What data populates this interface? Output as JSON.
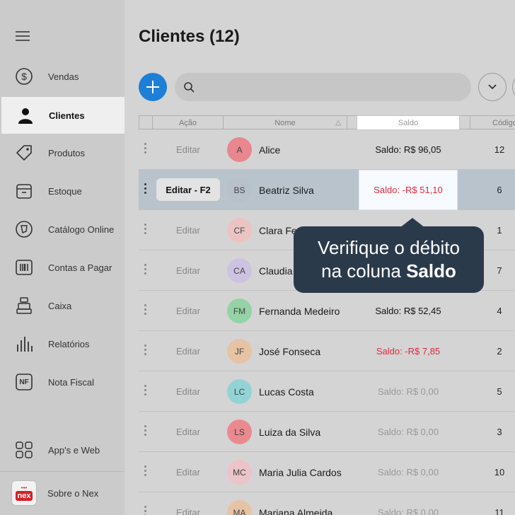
{
  "sidebar": {
    "items": [
      {
        "label": "Vendas",
        "icon": "dollar-circle-icon"
      },
      {
        "label": "Clientes",
        "icon": "person-icon",
        "active": true
      },
      {
        "label": "Produtos",
        "icon": "tag-icon"
      },
      {
        "label": "Estoque",
        "icon": "box-icon"
      },
      {
        "label": "Catálogo Online",
        "icon": "catalog-icon"
      },
      {
        "label": "Contas a Pagar",
        "icon": "barcode-icon"
      },
      {
        "label": "Caixa",
        "icon": "register-icon"
      },
      {
        "label": "Relatórios",
        "icon": "bars-icon"
      },
      {
        "label": "Nota Fiscal",
        "icon": "nf-icon"
      }
    ],
    "apps_label": "App's e Web",
    "about_label": "Sobre o Nex",
    "logo_text": "nex",
    "nf_text": "NF"
  },
  "header": {
    "title": "Clientes (12)"
  },
  "search": {
    "placeholder": ""
  },
  "table": {
    "columns": {
      "acao": "Ação",
      "nome": "Nome",
      "saldo": "Saldo",
      "codigo": "Código"
    },
    "rows": [
      {
        "action": "Editar",
        "initials": "A",
        "name": "Alice",
        "saldo": "Saldo: R$ 96,05",
        "code": "12",
        "color": "#e9868e"
      },
      {
        "action": "Editar - F2",
        "initials": "BS",
        "name": "Beatriz Silva",
        "saldo": "Saldo: -R$ 51,10",
        "code": "6",
        "color": "#b7c0cb"
      },
      {
        "action": "Editar",
        "initials": "CF",
        "name": "Clara Fe",
        "saldo": "",
        "code": "1",
        "color": "#ecc3c3"
      },
      {
        "action": "Editar",
        "initials": "CA",
        "name": "Claudia",
        "saldo": "",
        "code": "7",
        "color": "#cdc3e0"
      },
      {
        "action": "Editar",
        "initials": "FM",
        "name": "Fernanda Medeiro",
        "saldo": "Saldo: R$ 52,45",
        "code": "4",
        "color": "#93d3a6"
      },
      {
        "action": "Editar",
        "initials": "JF",
        "name": "José Fonseca",
        "saldo": "Saldo: -R$ 7,85",
        "code": "2",
        "color": "#e6c3a3"
      },
      {
        "action": "Editar",
        "initials": "LC",
        "name": "Lucas Costa",
        "saldo": "Saldo: R$ 0,00",
        "code": "5",
        "color": "#93d3d3"
      },
      {
        "action": "Editar",
        "initials": "LS",
        "name": "Luiza da Silva",
        "saldo": "Saldo: R$ 0,00",
        "code": "3",
        "color": "#e98a8f"
      },
      {
        "action": "Editar",
        "initials": "MC",
        "name": "Maria Julia Cardos",
        "saldo": "Saldo: R$ 0,00",
        "code": "10",
        "color": "#ebc3c8"
      },
      {
        "action": "Editar",
        "initials": "MA",
        "name": "Mariana Almeida",
        "saldo": "Saldo: R$ 0,00",
        "code": "11",
        "color": "#e6c3a3"
      }
    ]
  },
  "tooltip": {
    "line1": "Verifique o débito",
    "line2_prefix": "na coluna ",
    "line2_bold": "Saldo"
  },
  "colors": {
    "accent": "#1e7fd6",
    "negative": "#e3283d",
    "tooltip_bg": "#2b3a4b"
  }
}
